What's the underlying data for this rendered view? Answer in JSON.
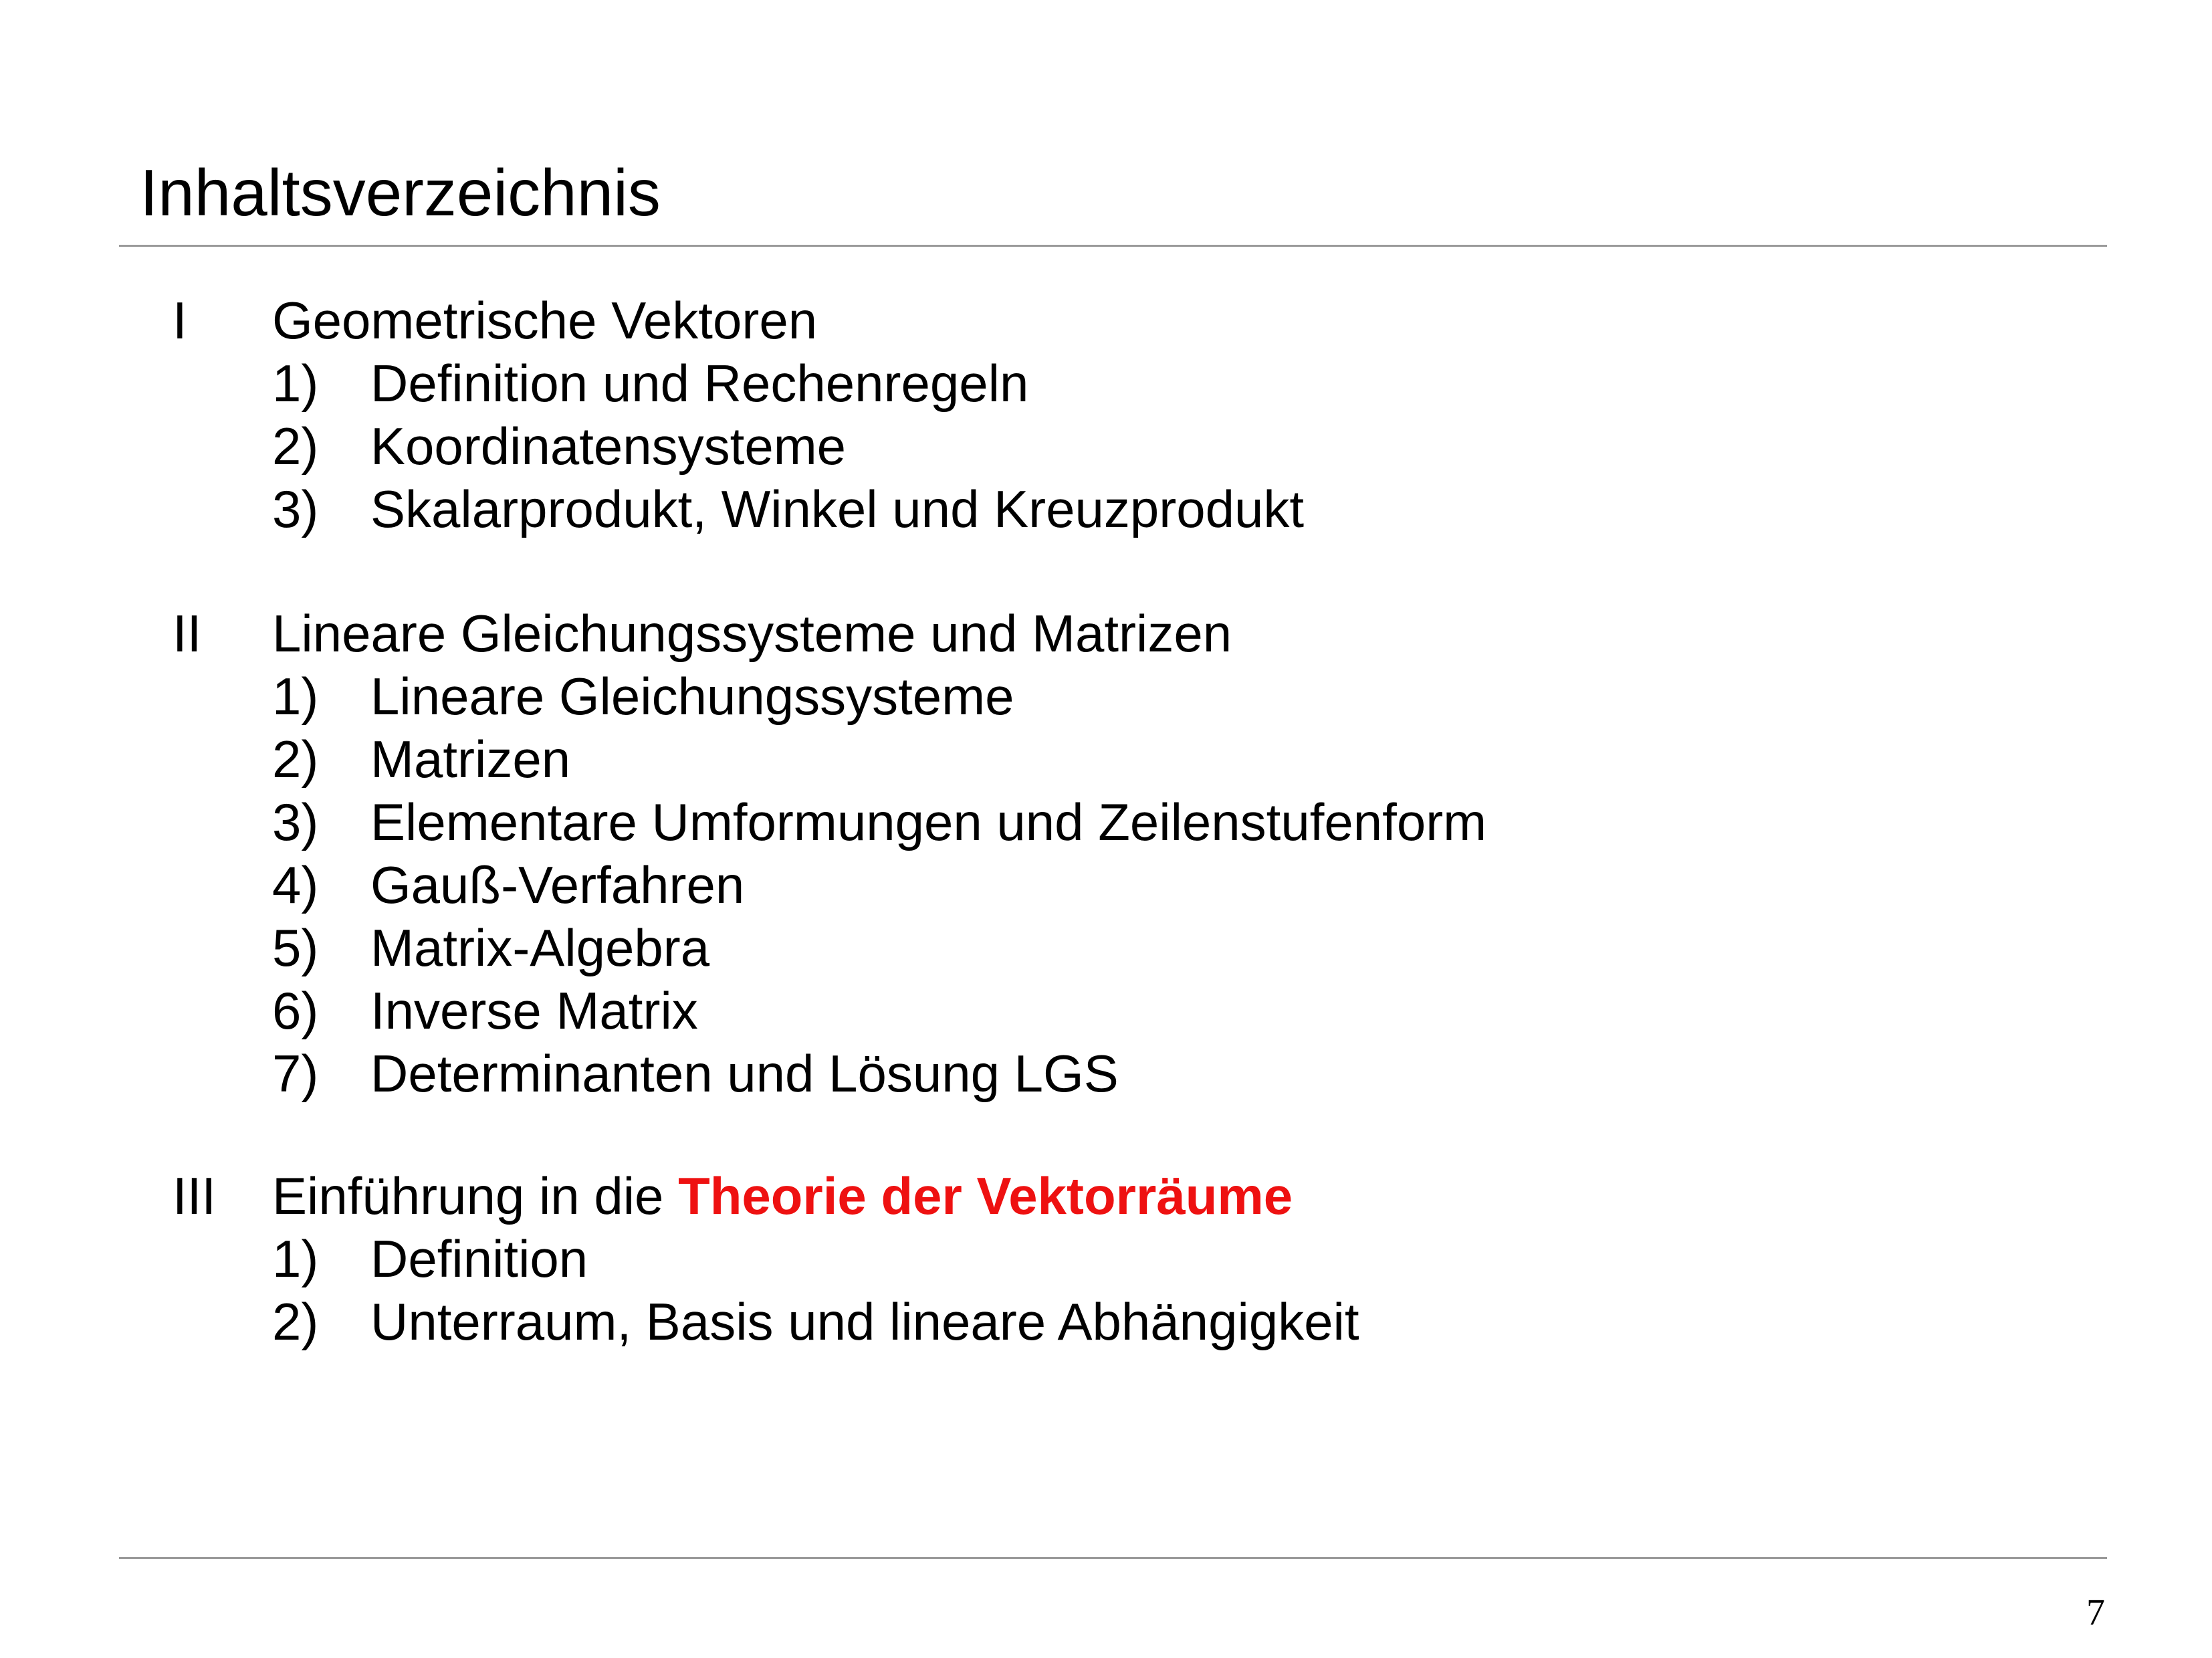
{
  "title": "Inhaltsverzeichnis",
  "page_number": "7",
  "accent_color": "#ee1111",
  "sections": [
    {
      "numeral": "I",
      "title": "Geometrische Vektoren",
      "items": [
        {
          "num": "1)",
          "text": "Definition und Rechenregeln"
        },
        {
          "num": "2)",
          "text": "Koordinatensysteme"
        },
        {
          "num": "3)",
          "text": "Skalarprodukt, Winkel und Kreuzprodukt"
        }
      ]
    },
    {
      "numeral": "II",
      "title": "Lineare Gleichungssysteme und Matrizen",
      "items": [
        {
          "num": "1)",
          "text": "Lineare Gleichungssysteme"
        },
        {
          "num": "2)",
          "text": "Matrizen"
        },
        {
          "num": "3)",
          "text": "Elementare Umformungen und Zeilenstufenform"
        },
        {
          "num": "4)",
          "text": "Gauß-Verfahren"
        },
        {
          "num": "5)",
          "text": "Matrix-Algebra"
        },
        {
          "num": "6)",
          "text": "Inverse Matrix"
        },
        {
          "num": "7)",
          "text": "Determinanten und Lösung LGS"
        }
      ]
    },
    {
      "numeral": "III",
      "title_prefix": "Einführung in die ",
      "title_highlight": "Theorie der Vektorräume",
      "items": [
        {
          "num": "1)",
          "text": "Definition"
        },
        {
          "num": "2)",
          "text": "Unterraum, Basis und lineare Abhängigkeit"
        }
      ]
    }
  ]
}
